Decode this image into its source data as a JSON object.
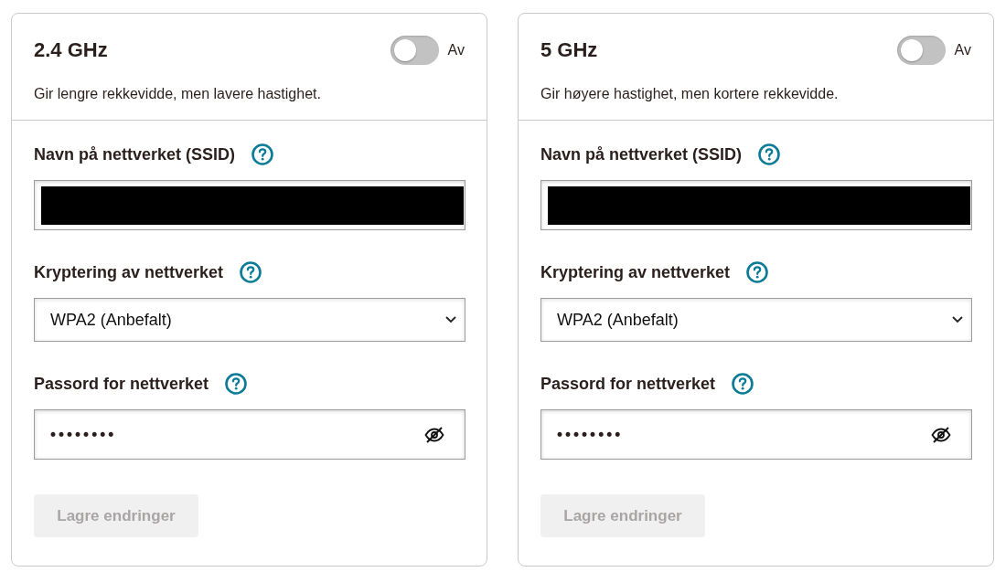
{
  "bands": [
    {
      "title": "2.4 GHz",
      "enabled": false,
      "toggle_label": "Av",
      "description": "Gir lengre rekkevidde, men lavere hastighet.",
      "fields": [
        {
          "kind": "text",
          "label": "Navn på nettverket (SSID)",
          "redacted": true
        },
        {
          "kind": "select",
          "label": "Kryptering av nettverket",
          "value": "WPA2 (Anbefalt)"
        },
        {
          "kind": "password",
          "label": "Passord for nettverket",
          "value": "••••••••",
          "revealed": false
        }
      ],
      "save_button": {
        "label": "Lagre endringer",
        "disabled": true
      }
    },
    {
      "title": "5 GHz",
      "enabled": false,
      "toggle_label": "Av",
      "description": "Gir høyere hastighet, men kortere rekkevidde.",
      "fields": [
        {
          "kind": "text",
          "label": "Navn på nettverket (SSID)",
          "redacted": true
        },
        {
          "kind": "select",
          "label": "Kryptering av nettverket",
          "value": "WPA2 (Anbefalt)"
        },
        {
          "kind": "password",
          "label": "Passord for nettverket",
          "value": "••••••••",
          "revealed": false
        }
      ],
      "save_button": {
        "label": "Lagre endringer",
        "disabled": true
      }
    }
  ]
}
